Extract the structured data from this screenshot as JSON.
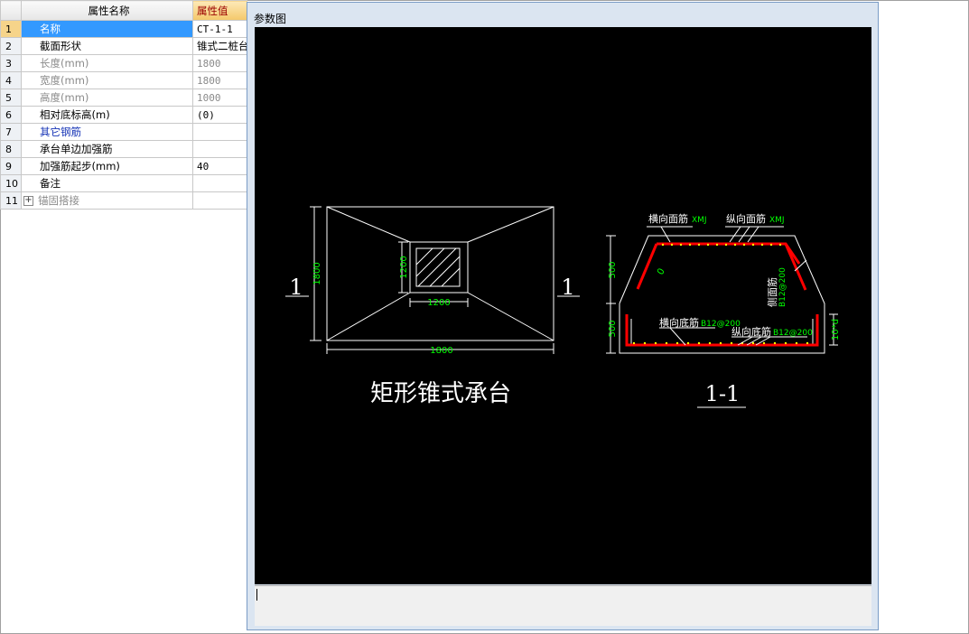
{
  "grid": {
    "header_name": "属性名称",
    "header_value": "属性值",
    "rows": [
      {
        "num": "1",
        "name": "名称",
        "value": "CT-1-1"
      },
      {
        "num": "2",
        "name": "截面形状",
        "value": "锥式二桩台"
      },
      {
        "num": "3",
        "name": "长度(mm)",
        "value": "1800"
      },
      {
        "num": "4",
        "name": "宽度(mm)",
        "value": "1800"
      },
      {
        "num": "5",
        "name": "高度(mm)",
        "value": "1000"
      },
      {
        "num": "6",
        "name": "相对底标高(m)",
        "value": "(0)"
      },
      {
        "num": "7",
        "name": "其它钢筋",
        "value": ""
      },
      {
        "num": "8",
        "name": "承台单边加强筋",
        "value": ""
      },
      {
        "num": "9",
        "name": "加强筋起步(mm)",
        "value": "40"
      },
      {
        "num": "10",
        "name": "备注",
        "value": ""
      },
      {
        "num": "11",
        "name": "锚固搭接",
        "value": ""
      }
    ],
    "expand_glyph": "+"
  },
  "dialog": {
    "title": "参数图"
  },
  "drawing": {
    "plan": {
      "dim_width": "1800",
      "dim_height": "1800",
      "inner_width": "1200",
      "inner_height": "1200",
      "section_mark": "1",
      "caption": "矩形锥式承台"
    },
    "section": {
      "caption": "1-1",
      "label_top_transverse": "横向面筋",
      "label_top_transverse_code": "XMJ",
      "label_top_longitudinal": "纵向面筋",
      "label_top_longitudinal_code": "XMJ",
      "label_side": "侧面筋",
      "label_side_code": "B12@200",
      "label_bottom_transverse": "横向底筋",
      "label_bottom_transverse_code": "B12@200",
      "label_bottom_longitudinal": "纵向底筋",
      "label_bottom_longitudinal_code": "B12@200",
      "dim_upper": "500",
      "dim_lower": "500",
      "dim_right": "10*d",
      "slope_mark": "0"
    },
    "colors": {
      "line": "#ffffff",
      "dimension": "#00ff00",
      "rebar": "#ff0000",
      "point": "#ffff00",
      "background": "#000000"
    }
  }
}
